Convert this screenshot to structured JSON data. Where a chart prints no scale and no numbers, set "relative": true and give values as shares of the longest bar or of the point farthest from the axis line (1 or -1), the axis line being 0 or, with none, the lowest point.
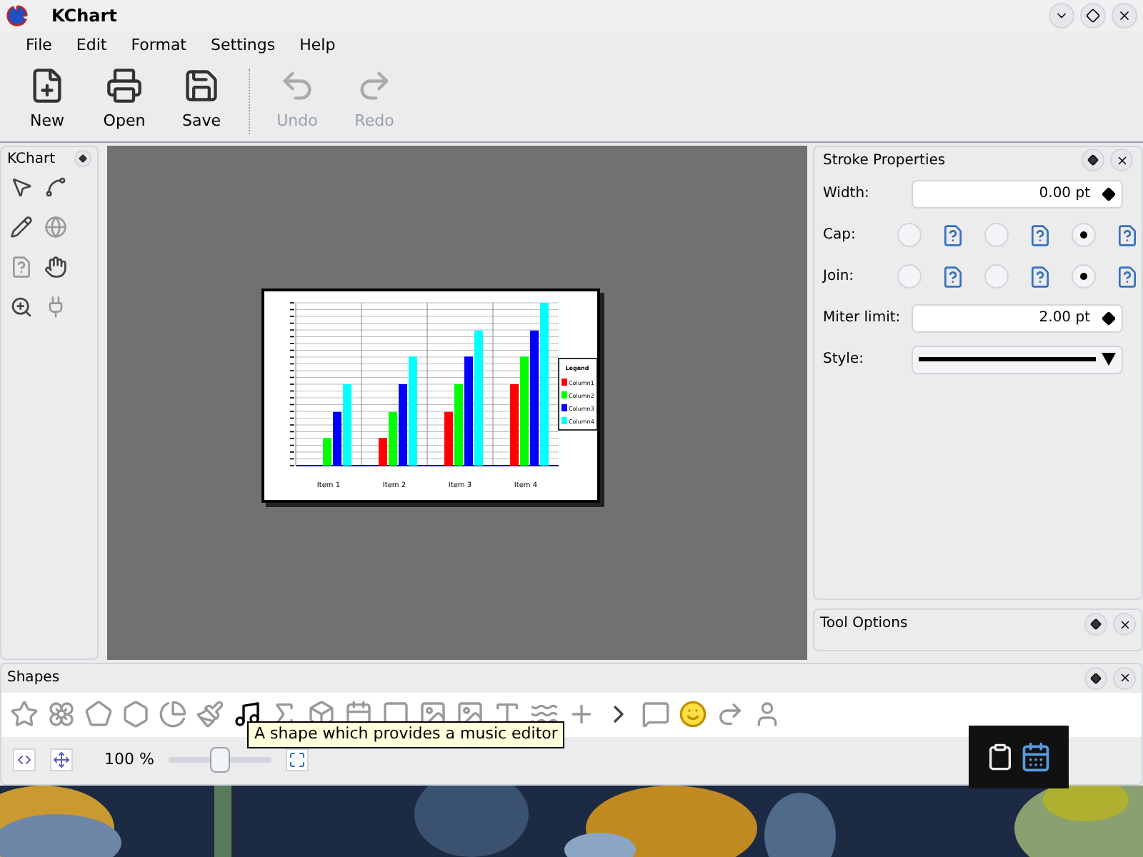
{
  "window": {
    "title": "KChart"
  },
  "menu": [
    "File",
    "Edit",
    "Format",
    "Settings",
    "Help"
  ],
  "toolbar": [
    {
      "kind": "new",
      "label": "New",
      "disabled": false
    },
    {
      "kind": "open",
      "label": "Open",
      "disabled": false
    },
    {
      "kind": "save",
      "label": "Save",
      "disabled": false
    },
    {
      "kind": "undo",
      "label": "Undo",
      "disabled": true
    },
    {
      "kind": "redo",
      "label": "Redo",
      "disabled": true
    }
  ],
  "tools_dock": {
    "title": "KChart"
  },
  "document": {
    "chart_data": {
      "type": "bar",
      "categories": [
        "Item 1",
        "Item 2",
        "Item 3",
        "Item 4"
      ],
      "relative": true,
      "legend": "right",
      "legend_title": "Legend",
      "series": [
        {
          "name": "Column1",
          "color": "#ff0000",
          "values": [
            0,
            0.17,
            0.33,
            0.5
          ]
        },
        {
          "name": "Column2",
          "color": "#00ff00",
          "values": [
            0.17,
            0.33,
            0.5,
            0.67
          ]
        },
        {
          "name": "Column3",
          "color": "#0000ff",
          "values": [
            0.33,
            0.5,
            0.67,
            0.83
          ]
        },
        {
          "name": "Column4",
          "color": "#00ffff",
          "values": [
            0.5,
            0.67,
            0.83,
            1
          ]
        }
      ]
    }
  },
  "stroke_properties": {
    "title": "Stroke Properties",
    "width": {
      "label": "Width:",
      "value": "0.00 pt"
    },
    "cap": {
      "label": "Cap:",
      "options": [
        {
          "selected": false
        },
        {
          "selected": false
        },
        {
          "selected": true
        }
      ]
    },
    "join": {
      "label": "Join:",
      "options": [
        {
          "selected": false
        },
        {
          "selected": false
        },
        {
          "selected": true
        }
      ]
    },
    "miter_limit": {
      "label": "Miter limit:",
      "value": "2.00 pt"
    },
    "style": {
      "label": "Style:"
    }
  },
  "tool_options": {
    "title": "Tool Options"
  },
  "shapes": {
    "title": "Shapes",
    "tooltip": "A shape which provides a music editor"
  },
  "zoom": {
    "reading": "100 %",
    "level": 0.5
  }
}
